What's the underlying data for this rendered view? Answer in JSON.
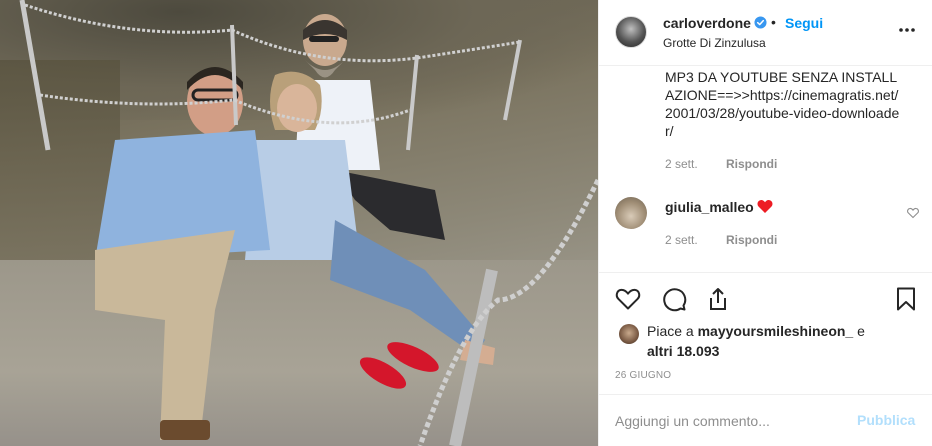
{
  "post": {
    "author": {
      "username": "carloverdone",
      "location": "Grotte Di Zinzulusa",
      "follow_label": "Segui",
      "verified_color": "#3897f0"
    },
    "comments": [
      {
        "text": "MP3 DA YOUTUBE SENZA INSTALLAZIONE==>>https://cinemagratis.net/2001/03/28/youtube-video-downloader/",
        "time": "2 sett.",
        "reply_label": "Rispondi"
      },
      {
        "username": "giulia_malleo",
        "time": "2 sett.",
        "reply_label": "Rispondi",
        "heart_color": "#ed1c24"
      }
    ],
    "likes": {
      "prefix": "Piace a ",
      "user": "mayyoursmileshineon_",
      "middle": " e ",
      "others": "altri 18.093"
    },
    "date": "26 GIUGNO",
    "add_comment": {
      "placeholder": "Aggiungi un commento...",
      "publish_label": "Pubblica"
    }
  },
  "icons": {
    "more": "more-options-icon",
    "like": "heart-icon",
    "comment": "comment-icon",
    "share": "share-icon",
    "save": "bookmark-icon"
  },
  "colors": {
    "link": "#0095f6",
    "publish_disabled": "#b2dffc",
    "muted": "#8e8e8e"
  }
}
